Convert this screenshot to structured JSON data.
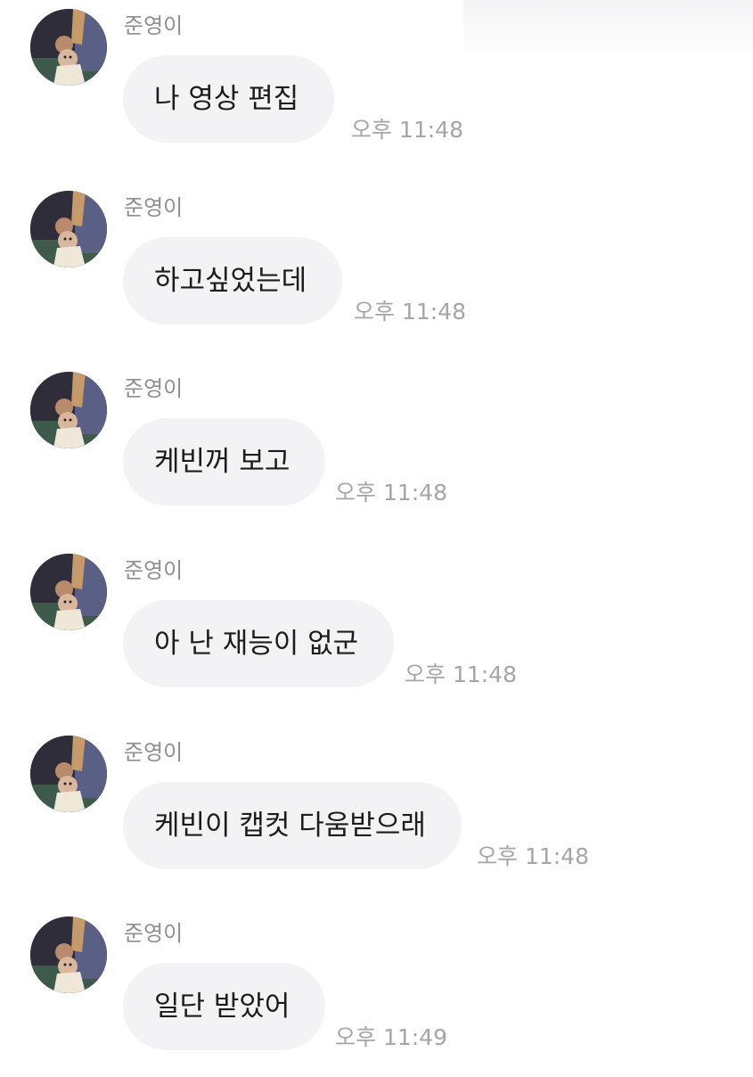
{
  "messages": [
    {
      "sender": "준영이",
      "text": "나 영상 편집",
      "time": "오후 11:48"
    },
    {
      "sender": "준영이",
      "text": "하고싶었는데",
      "time": "오후 11:48"
    },
    {
      "sender": "준영이",
      "text": "케빈꺼 보고",
      "time": "오후 11:48"
    },
    {
      "sender": "준영이",
      "text": "아 난 재능이 없군",
      "time": "오후 11:48"
    },
    {
      "sender": "준영이",
      "text": "케빈이 캡컷 다움받으래",
      "time": "오후 11:48"
    },
    {
      "sender": "준영이",
      "text": "일단 받았어",
      "time": "오후 11:49"
    }
  ],
  "colors": {
    "bubble": "#f3f3f5",
    "sender_text": "#8e8e93",
    "time_text": "#a5a5aa",
    "message_text": "#1c1c1e"
  },
  "icons": {
    "avatar": "profile-photo"
  }
}
